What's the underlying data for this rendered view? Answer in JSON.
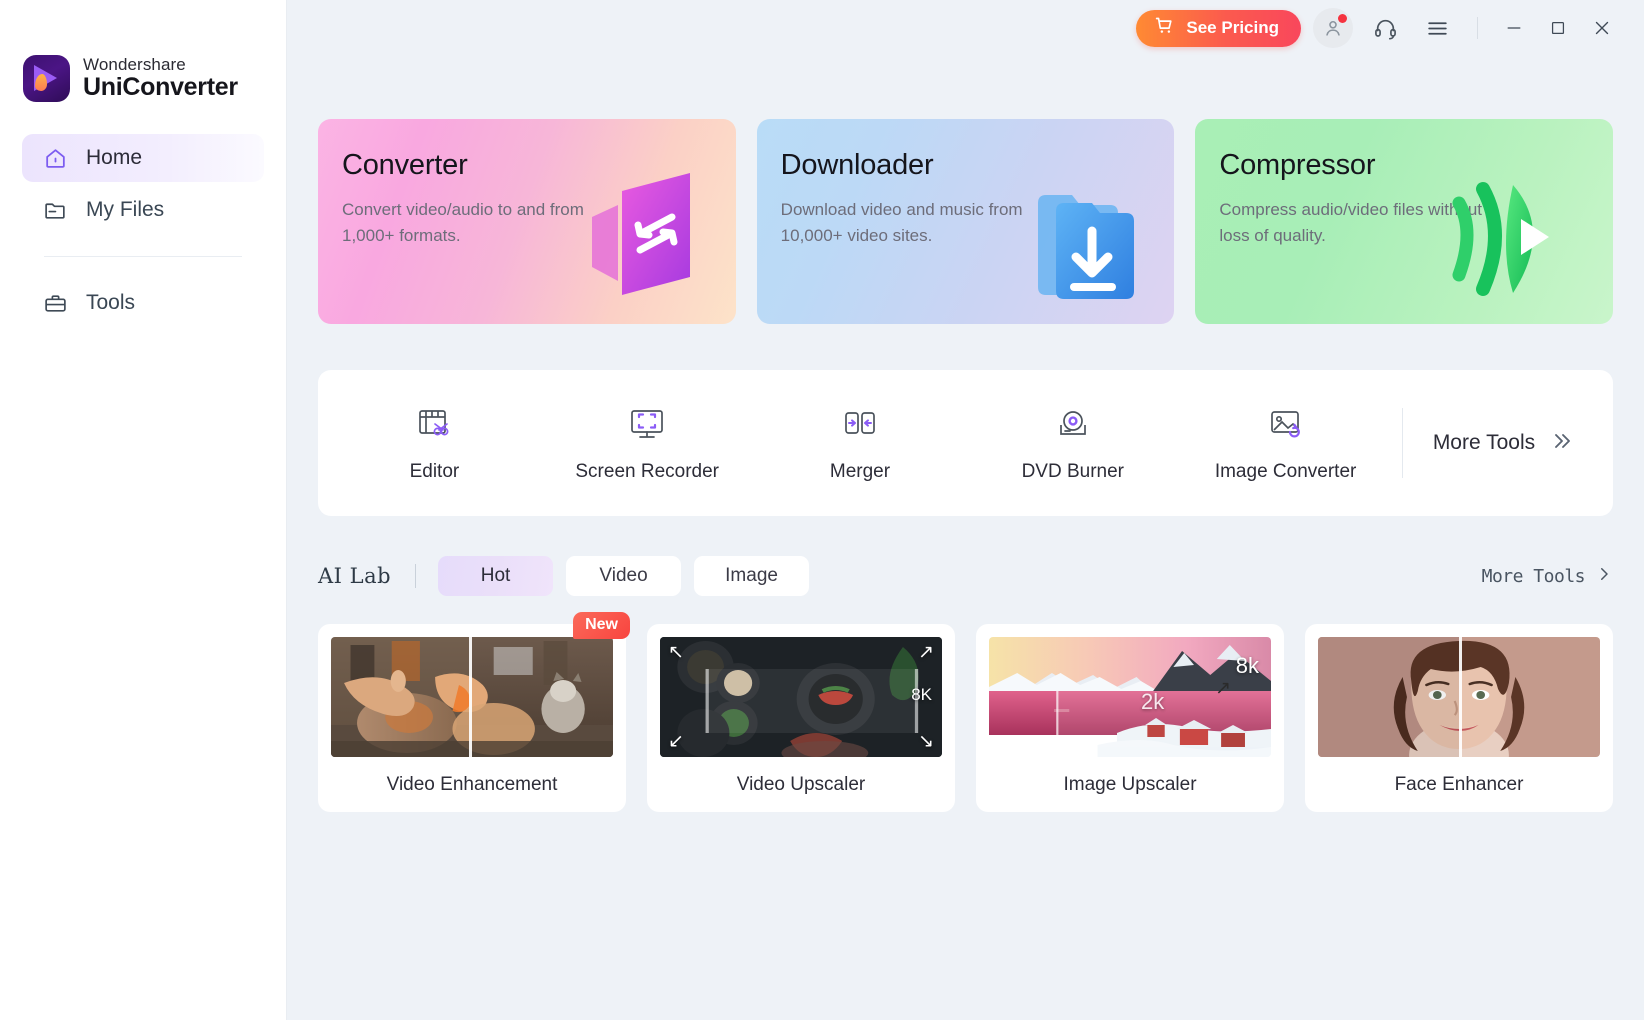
{
  "brand": {
    "company": "Wondershare",
    "product": "UniConverter",
    "logo_icon": "play-flame-logo-icon"
  },
  "sidebar": {
    "items": [
      {
        "label": "Home",
        "icon": "home-icon",
        "active": true
      },
      {
        "label": "My Files",
        "icon": "folder-icon",
        "active": false
      },
      {
        "label": "Tools",
        "icon": "toolbox-icon",
        "active": false
      }
    ]
  },
  "titlebar": {
    "pricing_label": "See Pricing",
    "cart_icon": "shopping-cart-icon",
    "account_icon": "user-account-icon",
    "support_icon": "headset-support-icon",
    "menu_icon": "hamburger-menu-icon",
    "minimize_icon": "minimize-icon",
    "maximize_icon": "maximize-icon",
    "close_icon": "close-icon",
    "notification_dot_color": "#f5333f",
    "pricing_gradient_from": "#ff8a33",
    "pricing_gradient_to": "#f9475c"
  },
  "features": [
    {
      "title": "Converter",
      "desc": "Convert video/audio to and from 1,000+ formats.",
      "art_icon": "convert-arrows-art",
      "accent": "#e056b6"
    },
    {
      "title": "Downloader",
      "desc": "Download video and music from 10,000+ video sites.",
      "art_icon": "download-arrow-art",
      "accent": "#3d9bf0"
    },
    {
      "title": "Compressor",
      "desc": "Compress audio/video files without loss of quality.",
      "art_icon": "compress-play-art",
      "accent": "#23c55e"
    }
  ],
  "tools": {
    "items": [
      {
        "label": "Editor",
        "icon": "film-scissors-icon"
      },
      {
        "label": "Screen Recorder",
        "icon": "monitor-capture-icon"
      },
      {
        "label": "Merger",
        "icon": "merge-arrows-icon"
      },
      {
        "label": "DVD Burner",
        "icon": "disc-burner-icon"
      },
      {
        "label": "Image Converter",
        "icon": "image-convert-icon"
      }
    ],
    "more_label": "More Tools",
    "more_icon": "double-chevron-right-icon"
  },
  "ailab": {
    "title": "AI Lab",
    "tabs": [
      {
        "label": "Hot",
        "active": true
      },
      {
        "label": "Video",
        "active": false
      },
      {
        "label": "Image",
        "active": false
      }
    ],
    "more_label": "More Tools",
    "more_icon": "chevron-right-icon",
    "cards": [
      {
        "label": "Video Enhancement",
        "badge": "New",
        "thumb": "cat-petting-before-after",
        "overlay": []
      },
      {
        "label": "Video Upscaler",
        "badge": "",
        "thumb": "dark-food-table-upscale",
        "overlay": [
          "8K"
        ]
      },
      {
        "label": "Image Upscaler",
        "badge": "",
        "thumb": "snowy-fjord-village-upscale",
        "overlay": [
          "2k",
          "8k"
        ]
      },
      {
        "label": "Face Enhancer",
        "badge": "",
        "thumb": "portrait-face-before-after",
        "overlay": []
      }
    ]
  }
}
